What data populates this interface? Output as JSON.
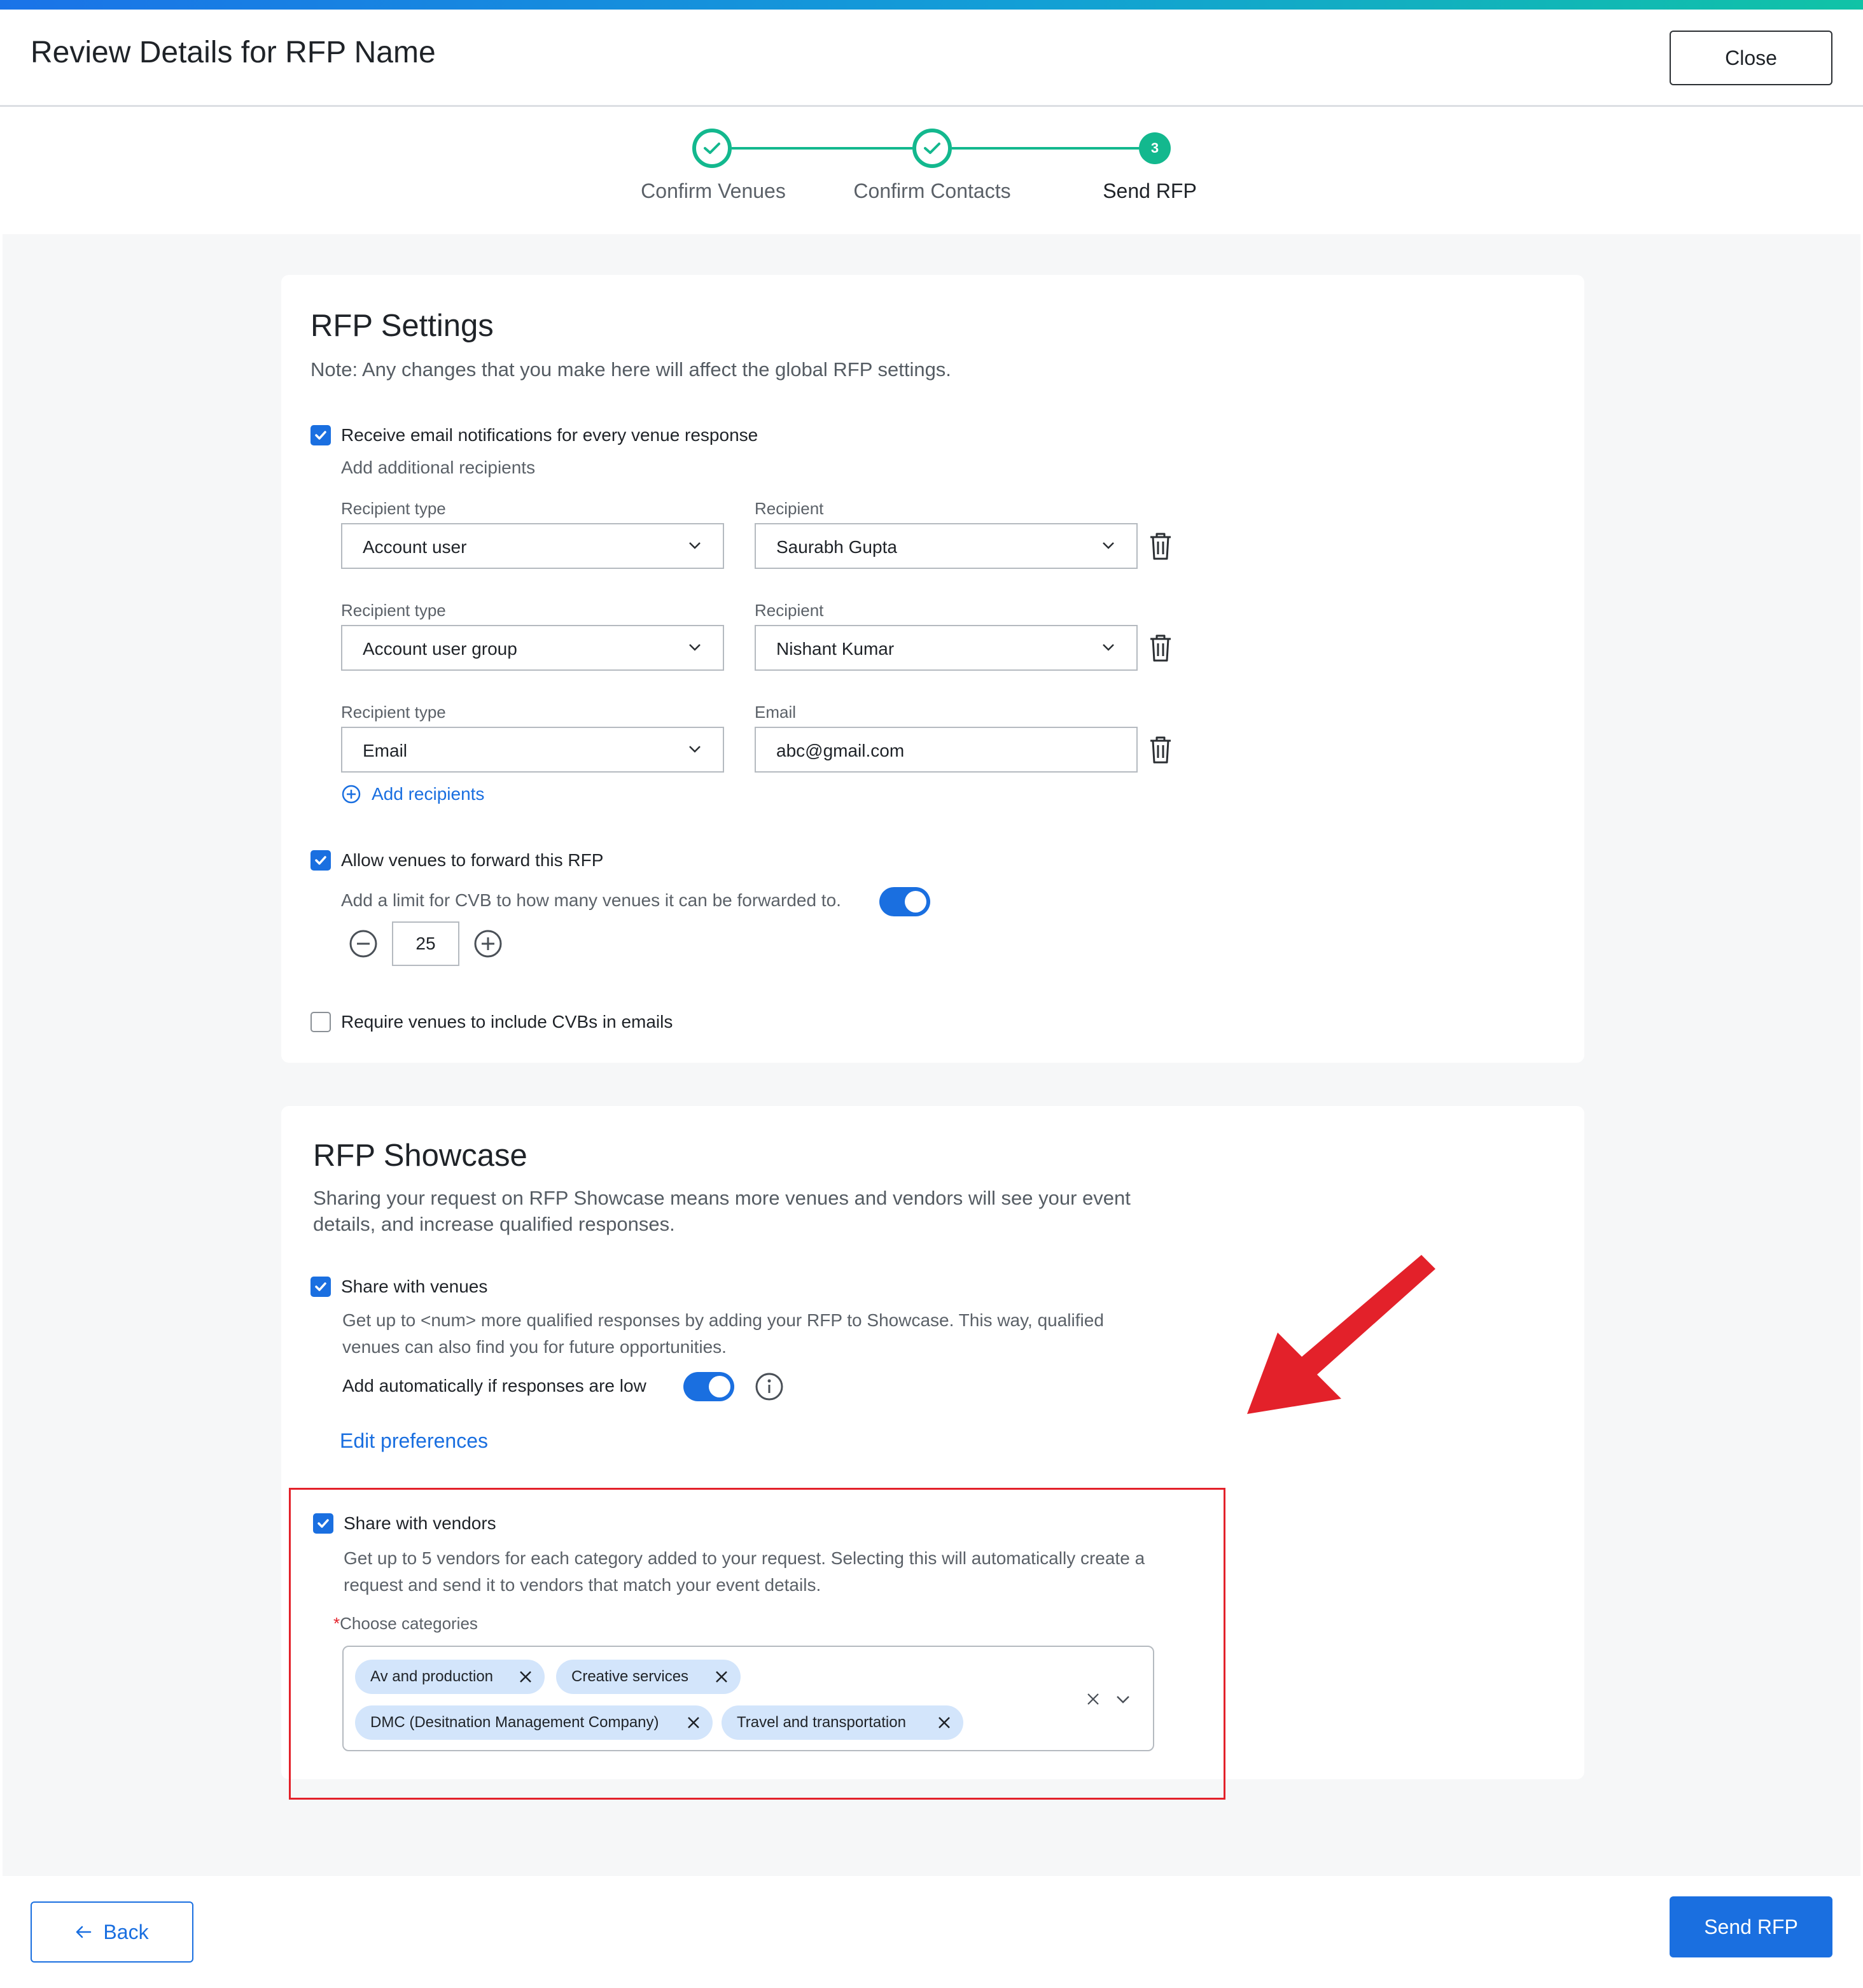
{
  "header": {
    "title": "Review Details for RFP Name",
    "close_label": "Close"
  },
  "steps": [
    {
      "label": "Confirm Venues",
      "state": "done"
    },
    {
      "label": "Confirm Contacts",
      "state": "done"
    },
    {
      "label": "Send RFP",
      "state": "current",
      "number": "3"
    }
  ],
  "settings": {
    "title": "RFP Settings",
    "note": "Note: Any changes that you make here will affect the global RFP settings.",
    "email_notifications": {
      "label": "Receive email notifications for every venue response",
      "checked": true
    },
    "additional_recipients_label": "Add additional recipients",
    "recipients": [
      {
        "type_label": "Recipient type",
        "type_value": "Account user",
        "value_label": "Recipient",
        "value": "Saurabh Gupta"
      },
      {
        "type_label": "Recipient type",
        "type_value": "Account user group",
        "value_label": "Recipient",
        "value": "Nishant Kumar"
      },
      {
        "type_label": "Recipient type",
        "type_value": "Email",
        "value_label": "Email",
        "value": "abc@gmail.com"
      }
    ],
    "add_recipients_label": "Add recipients",
    "allow_forward": {
      "label": "Allow venues to forward this RFP",
      "checked": true
    },
    "forward_limit_label": "Add a limit for CVB to how many venues it can be forwarded to.",
    "forward_limit_enabled": true,
    "forward_limit_value": "25",
    "require_cvb": {
      "label": "Require venues to include CVBs in emails",
      "checked": false
    }
  },
  "showcase": {
    "title": "RFP Showcase",
    "description": "Sharing your request on RFP Showcase means more venues and vendors will see your event details, and increase qualified responses.",
    "share_venues": {
      "label": "Share with venues",
      "checked": true,
      "description": "Get up to <num> more qualified responses by adding your RFP to Showcase. This way, qualified venues can also find you for future opportunities.",
      "auto_add_label": "Add automatically if responses are low",
      "auto_add_enabled": true
    },
    "edit_preferences_label": "Edit preferences",
    "share_vendors": {
      "label": "Share with vendors",
      "checked": true,
      "description": "Get up to 5 vendors for each category added to your request. Selecting this will automatically create a request and send it to vendors that match your event details.",
      "required_mark": "*",
      "categories_label": "Choose categories",
      "categories": [
        "Av and production",
        "Creative services",
        "DMC (Desitnation Management Company)",
        "Travel and transportation"
      ]
    }
  },
  "footer": {
    "back_label": "Back",
    "send_label": "Send RFP"
  },
  "colors": {
    "primary": "#1a6fe0",
    "step_green": "#13b88e",
    "annotation_red": "#e3212a"
  }
}
